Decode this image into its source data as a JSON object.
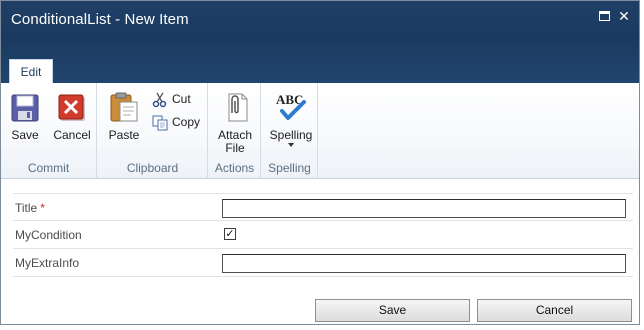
{
  "window": {
    "title": "ConditionalList - New Item",
    "maximize_icon": "maximize-icon",
    "close_icon": "close-icon"
  },
  "ribbon": {
    "active_tab": "Edit",
    "groups": {
      "commit": {
        "label": "Commit",
        "save": {
          "label": "Save",
          "icon": "save-disk-icon"
        },
        "cancel": {
          "label": "Cancel",
          "icon": "cancel-x-icon"
        }
      },
      "clipboard": {
        "label": "Clipboard",
        "paste": {
          "label": "Paste",
          "icon": "paste-clipboard-icon"
        },
        "cut": {
          "label": "Cut",
          "icon": "scissors-icon"
        },
        "copy": {
          "label": "Copy",
          "icon": "copy-icon"
        }
      },
      "actions": {
        "label": "Actions",
        "attach_file": {
          "label_line1": "Attach",
          "label_line2": "File",
          "icon": "paperclip-icon"
        }
      },
      "spelling": {
        "label": "Spelling",
        "spelling": {
          "label": "Spelling",
          "icon": "spelling-abc-icon",
          "icon_text": "ABC"
        }
      }
    }
  },
  "form": {
    "fields": [
      {
        "label": "Title",
        "required_marker": "*",
        "type": "text",
        "value": ""
      },
      {
        "label": "MyCondition",
        "type": "checkbox",
        "checked": true,
        "check_glyph": "✓"
      },
      {
        "label": "MyExtraInfo",
        "type": "text",
        "value": ""
      }
    ]
  },
  "buttons": {
    "save": "Save",
    "cancel": "Cancel"
  },
  "colors": {
    "titlebar": "#1f3f66",
    "required": "#d02b2b",
    "group_label": "#5b6f85"
  }
}
